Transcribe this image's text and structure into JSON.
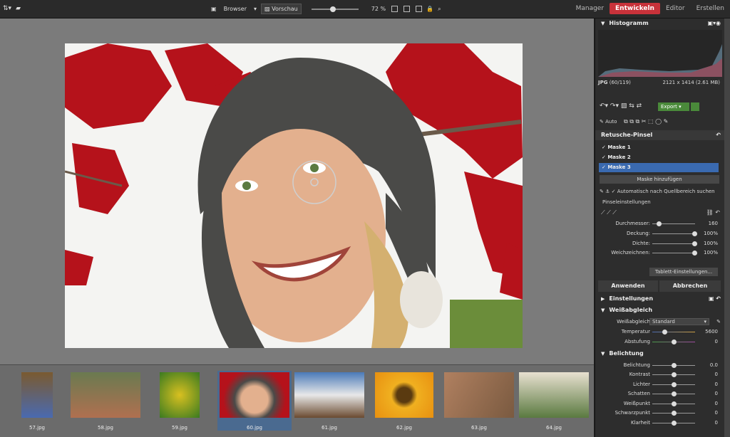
{
  "toolbar": {
    "browser_label": "Browser",
    "preview_label": "Vorschau",
    "zoom_value": "72 %"
  },
  "tabs": [
    {
      "label": "Manager"
    },
    {
      "label": "Entwickeln"
    },
    {
      "label": "Editor"
    },
    {
      "label": "Erstellen"
    }
  ],
  "histogram": {
    "title": "Histogramm",
    "format": "JPG",
    "index": "(60/119)",
    "dimensions": "2121 x 1414 (2.61 MB)"
  },
  "actions": {
    "export_label": "Export",
    "auto_label": "Auto"
  },
  "retouch": {
    "title": "Retusche-Pinsel",
    "masks": [
      "Maske 1",
      "Maske 2",
      "Maske 3"
    ],
    "add_mask_label": "Maske hinzufügen",
    "auto_source_label": "Automatisch nach Quellbereich suchen",
    "brush_settings_label": "Pinseleinstellungen",
    "sliders": [
      {
        "label": "Durchmesser:",
        "value": "160",
        "pos": 0.15
      },
      {
        "label": "Deckung:",
        "value": "100%",
        "pos": 1.0
      },
      {
        "label": "Dichte:",
        "value": "100%",
        "pos": 1.0
      },
      {
        "label": "Weichzeichnen:",
        "value": "100%",
        "pos": 1.0
      }
    ],
    "tablet_label": "Tablett-Einstellungen...",
    "apply_label": "Anwenden",
    "cancel_label": "Abbrechen"
  },
  "settings": {
    "title": "Einstellungen"
  },
  "white_balance": {
    "title": "Weißabgleich",
    "label": "Weißabgleich",
    "selected": "Standard",
    "temperature_label": "Temperatur",
    "temperature_value": "5600",
    "tint_label": "Abstufung",
    "tint_value": "0"
  },
  "exposure": {
    "title": "Belichtung",
    "rows": [
      {
        "label": "Belichtung",
        "value": "0.0"
      },
      {
        "label": "Kontrast",
        "value": "0"
      },
      {
        "label": "Lichter",
        "value": "0"
      },
      {
        "label": "Schatten",
        "value": "0"
      },
      {
        "label": "Weißpunkt",
        "value": "0"
      },
      {
        "label": "Schwarzpunkt",
        "value": "0"
      },
      {
        "label": "Klarheit",
        "value": "0"
      }
    ]
  },
  "filmstrip": [
    {
      "name": "57.jpg"
    },
    {
      "name": "58.jpg"
    },
    {
      "name": "59.jpg"
    },
    {
      "name": "60.jpg"
    },
    {
      "name": "61.jpg"
    },
    {
      "name": "62.jpg"
    },
    {
      "name": "63.jpg"
    },
    {
      "name": "64.jpg"
    }
  ]
}
